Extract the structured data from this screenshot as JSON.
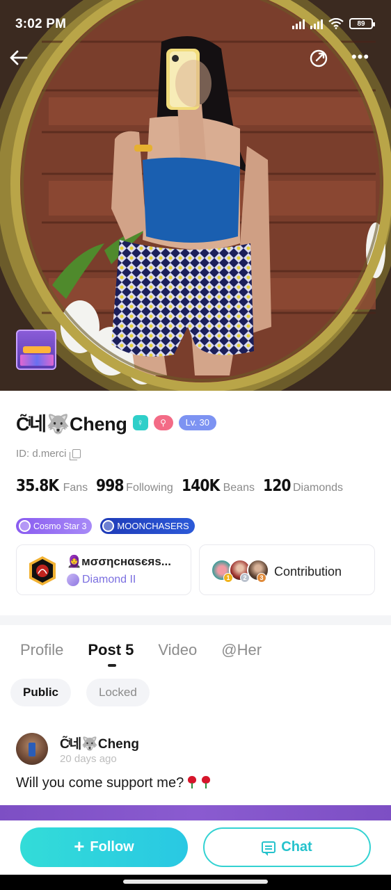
{
  "status_bar": {
    "time": "3:02 PM",
    "battery": "89"
  },
  "hero": {
    "event_badge_icon": "event-banner-icon"
  },
  "profile": {
    "display_name": "C̃ͥ네🐺Cheng",
    "level": "Lv. 30",
    "id_text": "ID: d.merci",
    "stats": [
      {
        "value": "35.8K",
        "label": "Fans"
      },
      {
        "value": "998",
        "label": "Following"
      },
      {
        "value": "140K",
        "label": "Beans"
      },
      {
        "value": "120",
        "label": "Diamonds"
      }
    ],
    "tags": {
      "cosmo": "Cosmo Star 3",
      "moon": "MOONCHASERS"
    },
    "family": {
      "name": "🧕мσσηcнαsєяs...",
      "rank": "Diamond II"
    },
    "contribution": {
      "label": "Contribution",
      "ranks": [
        "1",
        "2",
        "3"
      ]
    }
  },
  "tabs": [
    {
      "label": "Profile",
      "active": false
    },
    {
      "label": "Post 5",
      "active": true
    },
    {
      "label": "Video",
      "active": false
    },
    {
      "label": "@Her",
      "active": false
    }
  ],
  "subtabs": [
    {
      "label": "Public",
      "active": true
    },
    {
      "label": "Locked",
      "active": false
    }
  ],
  "post": {
    "author": "C̃ͥ네🐺Cheng",
    "time": "20 days ago",
    "text": "Will you come support me?"
  },
  "actions": {
    "follow": "Follow",
    "chat": "Chat"
  },
  "colors": {
    "accent": "#33dcd8",
    "level_badge": "#7d93f2",
    "rank_text": "#7b6fe0"
  }
}
